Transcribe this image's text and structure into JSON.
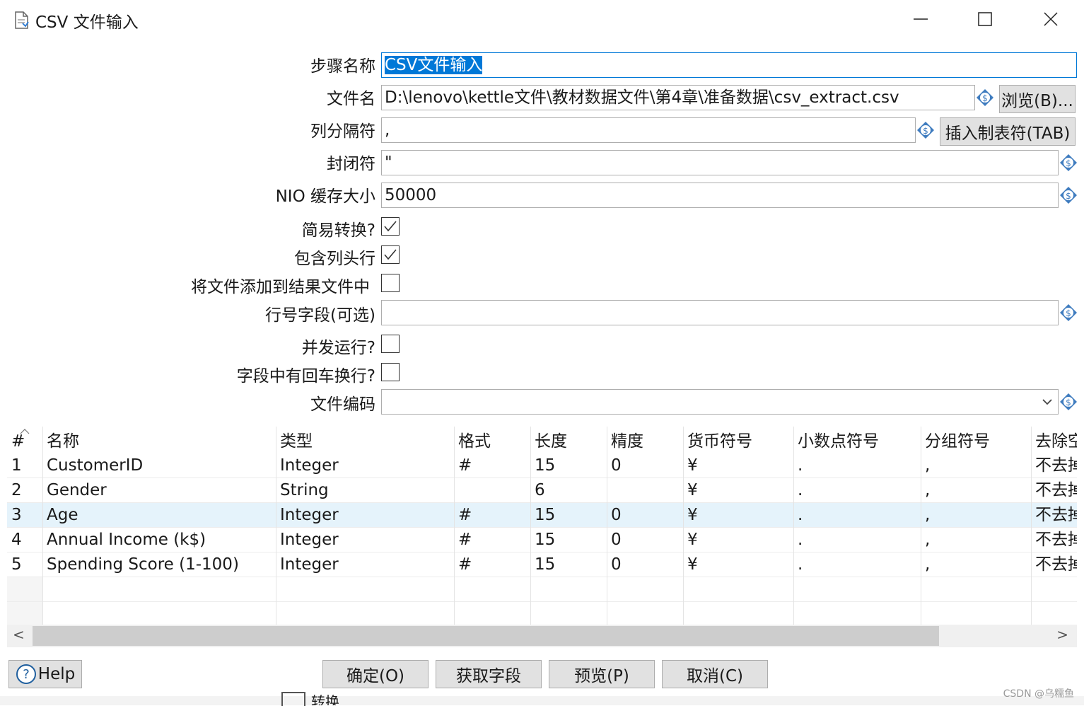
{
  "window": {
    "title": "CSV 文件输入",
    "icons": [
      "document-icon",
      "minimize-icon",
      "maximize-icon",
      "close-icon"
    ]
  },
  "form": {
    "step_name_label": "步骤名称",
    "step_name_value": "CSV文件输入",
    "filename_label": "文件名",
    "filename_value": "D:\\lenovo\\kettle文件\\教材数据文件\\第4章\\准备数据\\csv_extract.csv",
    "browse_button": "浏览(B)...",
    "delimiter_label": "列分隔符",
    "delimiter_value": ",",
    "insert_tab_button": "插入制表符(TAB)",
    "enclosure_label": "封闭符",
    "enclosure_value": "\"",
    "nio_label": "NIO 缓存大小",
    "nio_value": "50000",
    "lazy_label": "简易转换?",
    "lazy_checked": true,
    "header_label": "包含列头行",
    "header_checked": true,
    "add_result_label": "将文件添加到结果文件中",
    "add_result_checked": false,
    "rownum_label": "行号字段(可选)",
    "rownum_value": "",
    "parallel_label": "并发运行?",
    "parallel_checked": false,
    "newline_label": "字段中有回车换行?",
    "newline_checked": false,
    "encoding_label": "文件编码",
    "encoding_value": ""
  },
  "table": {
    "columns": [
      "#",
      "名称",
      "类型",
      "格式",
      "长度",
      "精度",
      "货币符号",
      "小数点符号",
      "分组符号",
      "去除空"
    ],
    "rows": [
      [
        "1",
        "CustomerID",
        "Integer",
        "#",
        "15",
        "0",
        "¥",
        ".",
        ",",
        "不去掉"
      ],
      [
        "2",
        "Gender",
        "String",
        "",
        "6",
        "",
        "¥",
        ".",
        ",",
        "不去掉"
      ],
      [
        "3",
        "Age",
        "Integer",
        "#",
        "15",
        "0",
        "¥",
        ".",
        ",",
        "不去掉"
      ],
      [
        "4",
        "Annual Income (k$)",
        "Integer",
        "#",
        "15",
        "0",
        "¥",
        ".",
        ",",
        "不去掉"
      ],
      [
        "5",
        "Spending Score (1-100)",
        "Integer",
        "#",
        "15",
        "0",
        "¥",
        ".",
        ",",
        "不去掉"
      ]
    ],
    "selected_row": 3,
    "scroll_left_label": "<",
    "scroll_right_label": ">"
  },
  "footer": {
    "help": "Help",
    "ok": "确定(O)",
    "get_fields": "获取字段",
    "preview": "预览(P)",
    "cancel": "取消(C)"
  },
  "background": {
    "behind_text": "转换"
  },
  "watermark": "CSDN @乌糯鱼",
  "colors": {
    "selection": "#0078d7",
    "selected_row": "#e5f3fb",
    "button": "#e1e1e1"
  }
}
